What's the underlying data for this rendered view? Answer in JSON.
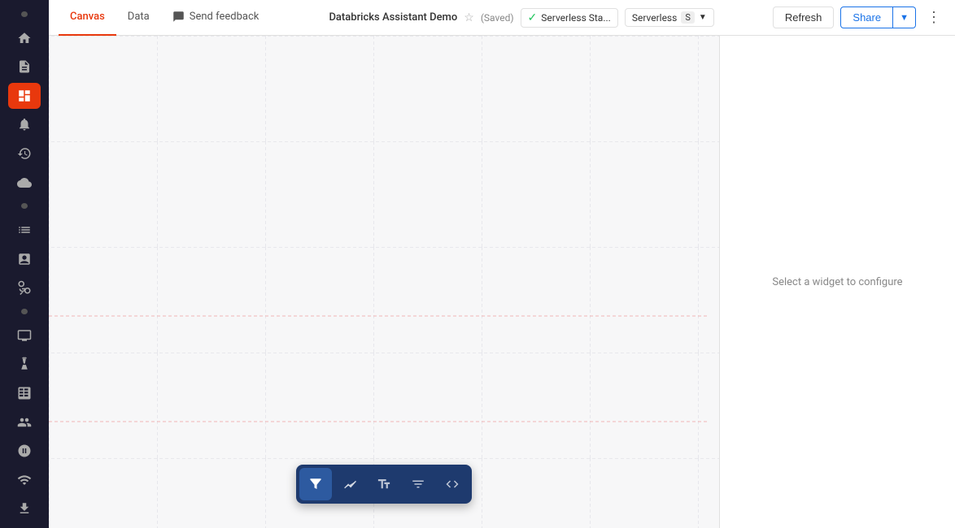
{
  "sidebar": {
    "items": [
      {
        "id": "dot-top",
        "type": "dot"
      },
      {
        "id": "nav-home",
        "icon": "home",
        "label": "Home"
      },
      {
        "id": "nav-notebook",
        "icon": "notebook",
        "label": "Notebooks"
      },
      {
        "id": "nav-dashboard",
        "icon": "dashboard",
        "label": "Dashboard",
        "active": true
      },
      {
        "id": "nav-alert",
        "icon": "alert",
        "label": "Alerts"
      },
      {
        "id": "nav-history",
        "icon": "history",
        "label": "History"
      },
      {
        "id": "nav-cloud",
        "icon": "cloud",
        "label": "Cloud"
      },
      {
        "id": "dot-mid",
        "type": "dot"
      },
      {
        "id": "nav-list",
        "icon": "list",
        "label": "List"
      },
      {
        "id": "nav-chart",
        "icon": "chart",
        "label": "Charts"
      },
      {
        "id": "nav-nodes",
        "icon": "nodes",
        "label": "Nodes"
      },
      {
        "id": "dot-mid2",
        "type": "dot"
      },
      {
        "id": "nav-tv",
        "icon": "tv",
        "label": "TV"
      },
      {
        "id": "nav-flask",
        "icon": "flask",
        "label": "Flask"
      },
      {
        "id": "nav-table",
        "icon": "table",
        "label": "Table"
      },
      {
        "id": "nav-partner",
        "icon": "partner",
        "label": "Partner"
      },
      {
        "id": "nav-ai",
        "icon": "ai",
        "label": "AI"
      },
      {
        "id": "nav-monitor",
        "icon": "monitor",
        "label": "Monitor"
      },
      {
        "id": "nav-connect",
        "icon": "connect",
        "label": "Connect"
      },
      {
        "id": "nav-export",
        "icon": "export",
        "label": "Export"
      }
    ]
  },
  "topbar": {
    "tabs": [
      {
        "id": "tab-canvas",
        "label": "Canvas",
        "active": true
      },
      {
        "id": "tab-data",
        "label": "Data",
        "active": false
      }
    ],
    "send_feedback_label": "Send feedback",
    "title": "Databricks Assistant Demo",
    "saved_label": "(Saved)",
    "status": {
      "text": "Serverless Sta...",
      "indicator": "✓"
    },
    "cluster": {
      "text": "Serverless",
      "key": "S"
    },
    "refresh_label": "Refresh",
    "share_label": "Share"
  },
  "canvas": {
    "empty_message": "Select a widget to configure"
  },
  "widget_toolbar": {
    "tools": [
      {
        "id": "tool-filter",
        "icon": "filter",
        "label": "Filter",
        "active": true
      },
      {
        "id": "tool-chart",
        "icon": "line-chart",
        "label": "Line Chart",
        "active": false
      },
      {
        "id": "tool-text",
        "icon": "text-box",
        "label": "Text Box",
        "active": false
      },
      {
        "id": "tool-widget-filter",
        "icon": "widget-filter",
        "label": "Widget Filter",
        "active": false
      },
      {
        "id": "tool-code",
        "icon": "code",
        "label": "Code",
        "active": false
      }
    ]
  }
}
